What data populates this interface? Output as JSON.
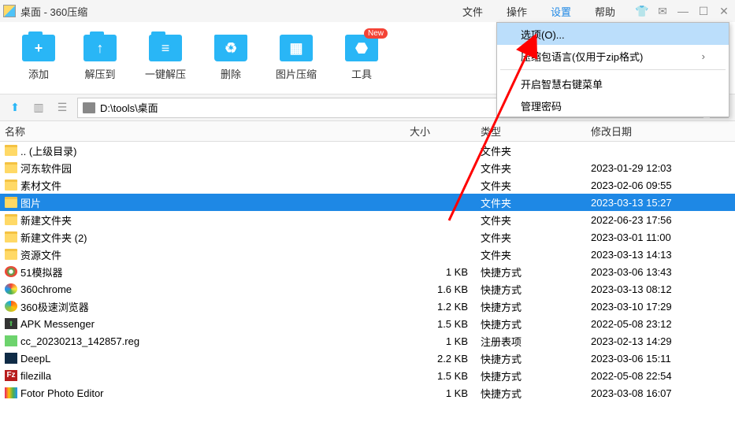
{
  "window": {
    "title": "桌面 - 360压缩"
  },
  "menubar": {
    "file": "文件",
    "operate": "操作",
    "settings": "设置",
    "help": "帮助"
  },
  "toolbar": {
    "add": "添加",
    "extract_to": "解压到",
    "one_click": "一键解压",
    "delete": "删除",
    "image_compress": "图片压缩",
    "tools": "工具",
    "new_badge": "New"
  },
  "nav": {
    "path": "D:\\tools\\桌面"
  },
  "columns": {
    "name": "名称",
    "size": "大小",
    "type": "类型",
    "date": "修改日期"
  },
  "type_labels": {
    "folder": "文件夹",
    "shortcut": "快捷方式",
    "regitem": "注册表项"
  },
  "files": [
    {
      "icon": "folder",
      "name": ".. (上级目录)",
      "size": "",
      "type": "文件夹",
      "date": ""
    },
    {
      "icon": "folder",
      "name": "河东软件园",
      "size": "",
      "type": "文件夹",
      "date": "2023-01-29 12:03"
    },
    {
      "icon": "folder",
      "name": "素材文件",
      "size": "",
      "type": "文件夹",
      "date": "2023-02-06 09:55"
    },
    {
      "icon": "folder",
      "name": "图片",
      "size": "",
      "type": "文件夹",
      "date": "2023-03-13 15:27",
      "selected": true
    },
    {
      "icon": "folder",
      "name": "新建文件夹",
      "size": "",
      "type": "文件夹",
      "date": "2022-06-23 17:56"
    },
    {
      "icon": "folder",
      "name": "新建文件夹 (2)",
      "size": "",
      "type": "文件夹",
      "date": "2023-03-01 11:00"
    },
    {
      "icon": "folder",
      "name": "资源文件",
      "size": "",
      "type": "文件夹",
      "date": "2023-03-13 14:13"
    },
    {
      "icon": "c1",
      "name": "51模拟器",
      "size": "1 KB",
      "type": "快捷方式",
      "date": "2023-03-06 13:43"
    },
    {
      "icon": "c2",
      "name": "360chrome",
      "size": "1.6 KB",
      "type": "快捷方式",
      "date": "2023-03-13 08:12"
    },
    {
      "icon": "c3",
      "name": "360极速浏览器",
      "size": "1.2 KB",
      "type": "快捷方式",
      "date": "2023-03-10 17:29"
    },
    {
      "icon": "apk",
      "name": "APK Messenger",
      "size": "1.5 KB",
      "type": "快捷方式",
      "date": "2022-05-08 23:12"
    },
    {
      "icon": "reg",
      "name": "cc_20230213_142857.reg",
      "size": "1 KB",
      "type": "注册表项",
      "date": "2023-02-13 14:29"
    },
    {
      "icon": "deepl",
      "name": "DeepL",
      "size": "2.2 KB",
      "type": "快捷方式",
      "date": "2023-03-06 15:11"
    },
    {
      "icon": "fz",
      "name": "filezilla",
      "size": "1.5 KB",
      "type": "快捷方式",
      "date": "2022-05-08 22:54"
    },
    {
      "icon": "fotor",
      "name": "Fotor Photo Editor",
      "size": "1 KB",
      "type": "快捷方式",
      "date": "2023-03-08 16:07"
    }
  ],
  "dropdown": {
    "options": "选项(O)...",
    "zip_lang": "压缩包语言(仅用于zip格式)",
    "smart_menu": "开启智慧右键菜单",
    "manage_pwd": "管理密码"
  }
}
